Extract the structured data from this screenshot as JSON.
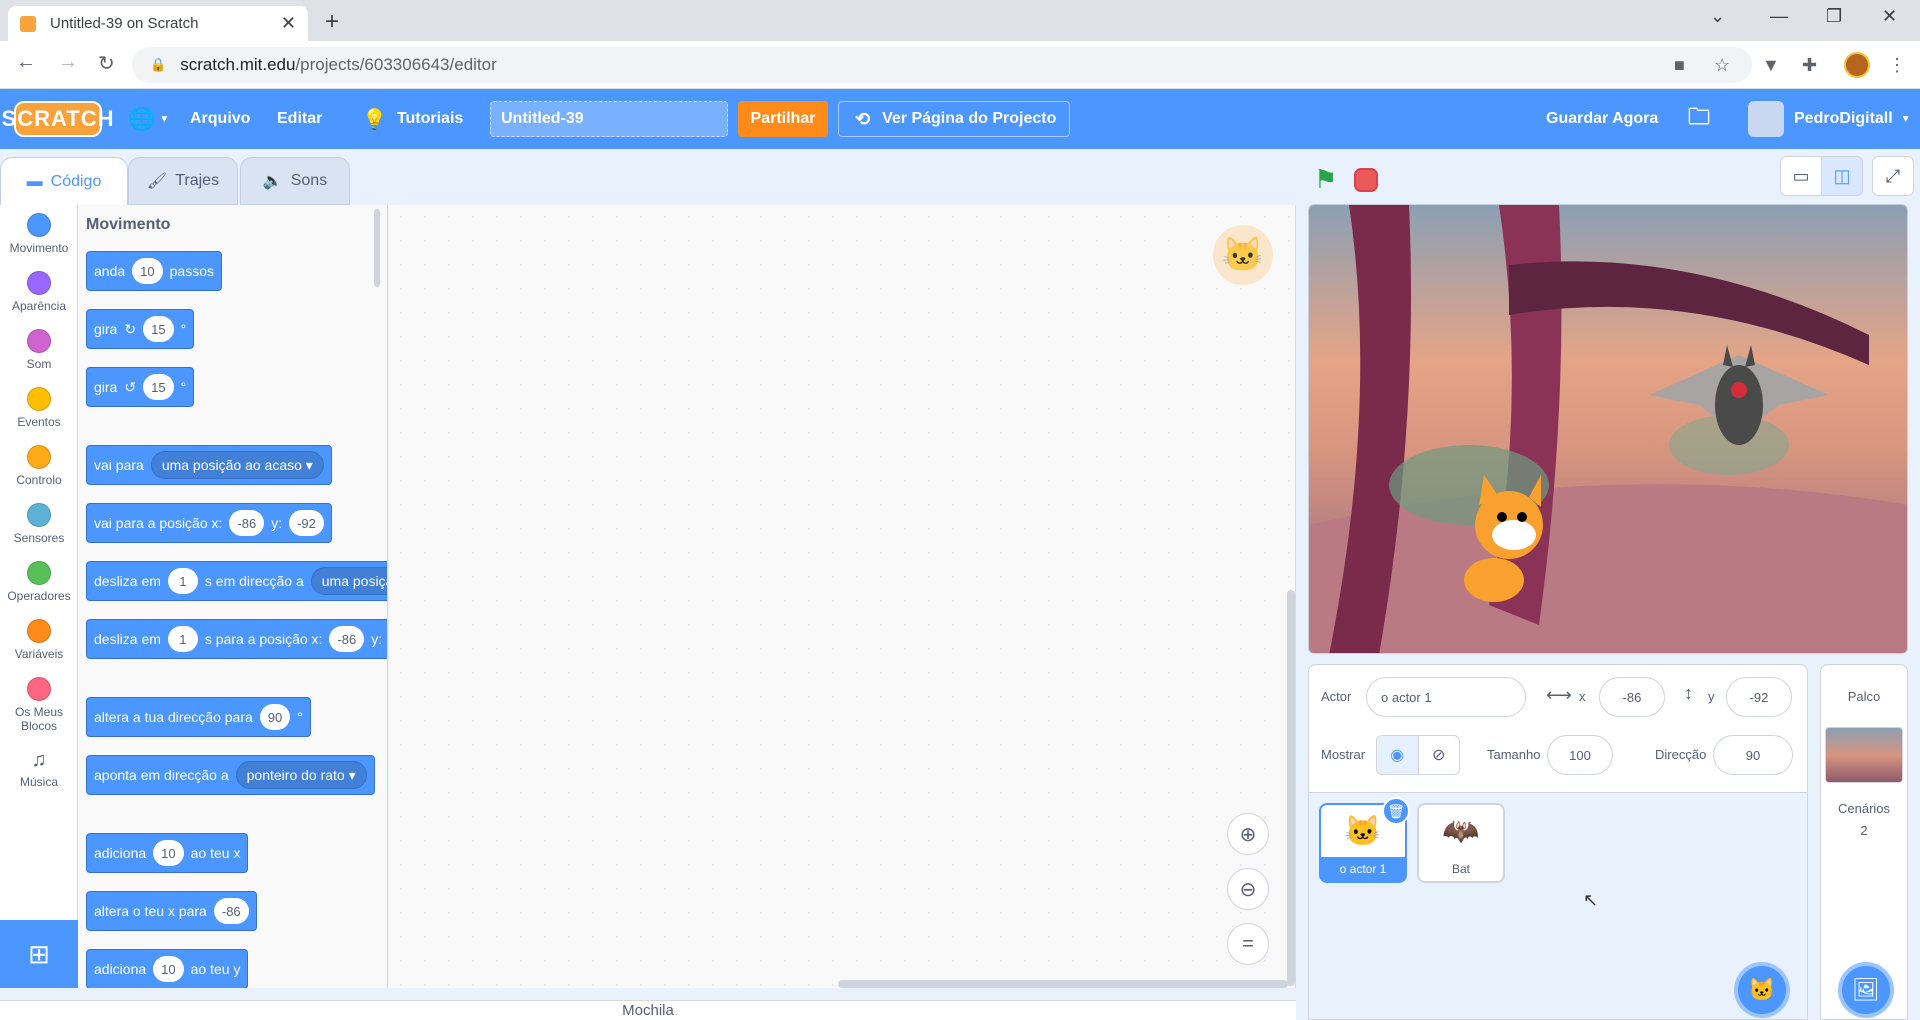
{
  "browser": {
    "tab_title": "Untitled-39 on Scratch",
    "url_host": "scratch.mit.edu",
    "url_path": "/projects/603306643/editor"
  },
  "menubar": {
    "logo": "SCRATCH",
    "arquivo": "Arquivo",
    "editar": "Editar",
    "tutoriais": "Tutoriais",
    "project_title": "Untitled-39",
    "share": "Partilhar",
    "see_project": "Ver Página do Projecto",
    "save_now": "Guardar Agora",
    "username": "PedroDigitall",
    "accent": "#4c97ff"
  },
  "editor_tabs": {
    "code": "Código",
    "costumes": "Trajes",
    "sounds": "Sons"
  },
  "categories": [
    {
      "label": "Movimento",
      "color": "#4c97ff"
    },
    {
      "label": "Aparência",
      "color": "#9966ff"
    },
    {
      "label": "Som",
      "color": "#cf63cf"
    },
    {
      "label": "Eventos",
      "color": "#ffbf00"
    },
    {
      "label": "Controlo",
      "color": "#ffab19"
    },
    {
      "label": "Sensores",
      "color": "#5cb1d6"
    },
    {
      "label": "Operadores",
      "color": "#59c059"
    },
    {
      "label": "Variáveis",
      "color": "#ff8c1a"
    },
    {
      "label": "Os Meus Blocos",
      "color": "#ff6680"
    },
    {
      "label": "Música",
      "color": ""
    }
  ],
  "palette": {
    "section": "Movimento",
    "blocks": {
      "move": {
        "a": "anda",
        "v": "10",
        "b": "passos"
      },
      "turn_right": {
        "a": "gira",
        "v": "15",
        "deg": "°"
      },
      "turn_left": {
        "a": "gira",
        "v": "15",
        "deg": "°"
      },
      "goto": {
        "a": "vai para",
        "d": "uma posição ao acaso"
      },
      "goto_xy": {
        "a": "vai para a posição x:",
        "x": "-86",
        "b": "y:",
        "y": "-92"
      },
      "glide_to": {
        "a": "desliza em",
        "v": "1",
        "b": "s em direcção a",
        "d": "uma posição"
      },
      "glide_xy": {
        "a": "desliza em",
        "v": "1",
        "b": "s para a posição x:",
        "x": "-86",
        "c": "y:"
      },
      "point_dir": {
        "a": "altera a tua direcção para",
        "v": "90",
        "deg": "°"
      },
      "point_towards": {
        "a": "aponta em direcção a",
        "d": "ponteiro do rato"
      },
      "change_x": {
        "a": "adiciona",
        "v": "10",
        "b": "ao teu x"
      },
      "set_x": {
        "a": "altera o teu x para",
        "v": "-86"
      },
      "change_y": {
        "a": "adiciona",
        "v": "10",
        "b": "ao teu y"
      }
    }
  },
  "backpack": "Mochila",
  "sprite_info": {
    "actor_label": "Actor",
    "actor_name": "o actor 1",
    "x_label": "x",
    "x": "-86",
    "y_label": "y",
    "y": "-92",
    "show_label": "Mostrar",
    "size_label": "Tamanho",
    "size": "100",
    "dir_label": "Direcção",
    "dir": "90"
  },
  "sprites": [
    {
      "name": "o actor 1",
      "selected": true
    },
    {
      "name": "Bat",
      "selected": false
    }
  ],
  "stage_pane": {
    "title": "Palco",
    "backdrops_label": "Cenários",
    "backdrops_count": "2"
  }
}
